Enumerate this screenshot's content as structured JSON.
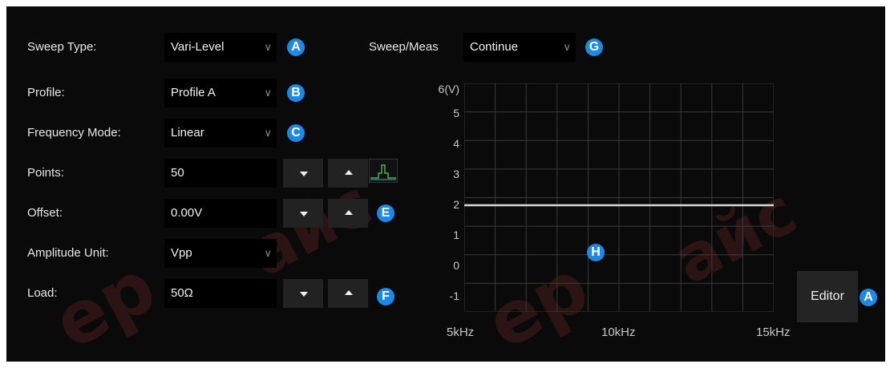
{
  "settings": {
    "sweep_type": {
      "label": "Sweep Type:",
      "value": "Vari-Level",
      "badge": "A"
    },
    "profile": {
      "label": "Profile:",
      "value": "Profile A",
      "badge": "B"
    },
    "frequency_mode": {
      "label": "Frequency Mode:",
      "value": "Linear",
      "badge": "C"
    },
    "points": {
      "label": "Points:",
      "value": "50"
    },
    "offset": {
      "label": "Offset:",
      "value": "0.00V",
      "badge": "E"
    },
    "amplitude_unit": {
      "label": "Amplitude Unit:",
      "value": "Vpp"
    },
    "load": {
      "label": "Load:",
      "value": "50Ω",
      "badge": "F"
    }
  },
  "sweep_meas": {
    "label": "Sweep/Meas",
    "value": "Continue",
    "badge": "G"
  },
  "chart_badge": "H",
  "editor": {
    "label": "Editor",
    "badge": "A"
  },
  "chart_data": {
    "type": "line",
    "y_unit_label": "6(V)",
    "y_ticks": [
      "5",
      "4",
      "3",
      "2",
      "1",
      "0",
      "-1"
    ],
    "x_ticks": [
      "5kHz",
      "10kHz",
      "15kHz"
    ],
    "ylim": [
      -1.5,
      6
    ],
    "xlim": [
      5,
      15
    ],
    "x_unit": "kHz",
    "grid": true,
    "series": [
      {
        "x": [
          5,
          15
        ],
        "values": [
          2,
          2
        ],
        "color": "#d8d8d8"
      }
    ]
  },
  "colors": {
    "badge": "#1e88e5",
    "background": "#0a0a0a",
    "grid": "#3a3a3a"
  }
}
